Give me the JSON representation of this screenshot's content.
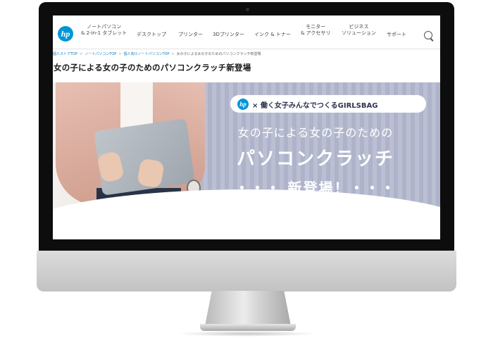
{
  "nav": {
    "logo_text": "hp",
    "items": [
      {
        "line1": "ノートパソコン",
        "line2": "& 2-in-1 タブレット"
      },
      {
        "line1": "デスクトップ",
        "line2": ""
      },
      {
        "line1": "プリンター",
        "line2": ""
      },
      {
        "line1": "3Dプリンター",
        "line2": ""
      },
      {
        "line1": "インク & トナー",
        "line2": ""
      },
      {
        "line1": "モニター",
        "line2": "& アクセサリ"
      },
      {
        "line1": "ビジネス",
        "line2": "ソリューション"
      },
      {
        "line1": "サポート",
        "line2": ""
      }
    ]
  },
  "breadcrumb": {
    "items": [
      "個人ストアTOP",
      "ノートパソコンTOP",
      "個人向けノートパソコンTOP"
    ],
    "current": "女の子による女の子のためのパソコンクラッチ新登場",
    "separator": ">"
  },
  "page_title": "女の子による女の子のためのパソコンクラッチ新登場",
  "banner": {
    "logo_text": "hp",
    "tagline": "× 働く女子みんなでつくるGIRLSBAG",
    "headline_1": "女の子による女の子のための",
    "headline_2": "パソコンクラッチ",
    "headline_3": "・・・ 新登場！・・・",
    "stripe_color": "#b4b8cd",
    "accent_color": "#0096d6"
  }
}
